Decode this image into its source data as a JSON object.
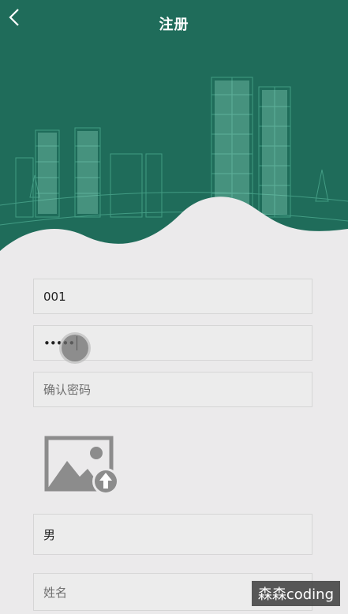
{
  "header": {
    "title": "注册",
    "back_icon": "chevron-left-icon",
    "background_color": "#1f6c5a"
  },
  "form": {
    "username_value": "001",
    "password_value": "•••••",
    "confirm_password_placeholder": "确认密码",
    "avatar_upload_icon": "image-upload-icon",
    "gender_value": "男",
    "name_placeholder": "姓名"
  },
  "watermark": "森森coding"
}
